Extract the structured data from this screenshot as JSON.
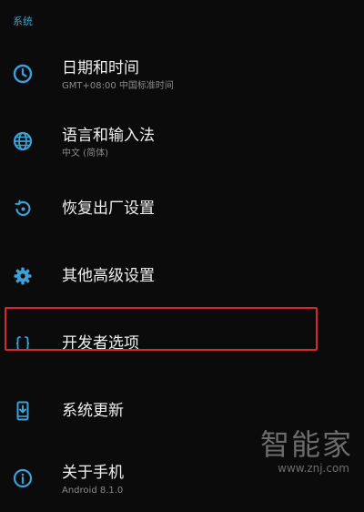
{
  "section_header": "系统",
  "colors": {
    "accent": "#3da0d6",
    "highlight": "#d8282e",
    "background": "#0b0b0b"
  },
  "items": [
    {
      "icon": "clock-icon",
      "title": "日期和时间",
      "summary": "GMT+08:00 中国标准时间"
    },
    {
      "icon": "globe-icon",
      "title": "语言和输入法",
      "summary": "中文 (简体)"
    },
    {
      "icon": "restore-icon",
      "title": "恢复出厂设置",
      "summary": ""
    },
    {
      "icon": "gear-icon",
      "title": "其他高级设置",
      "summary": ""
    },
    {
      "icon": "braces-icon",
      "title": "开发者选项",
      "summary": ""
    },
    {
      "icon": "system-update-icon",
      "title": "系统更新",
      "summary": ""
    },
    {
      "icon": "info-icon",
      "title": "关于手机",
      "summary": "Android 8.1.0"
    }
  ],
  "watermark": {
    "text": "智能家",
    "url": "www.znj.com"
  }
}
